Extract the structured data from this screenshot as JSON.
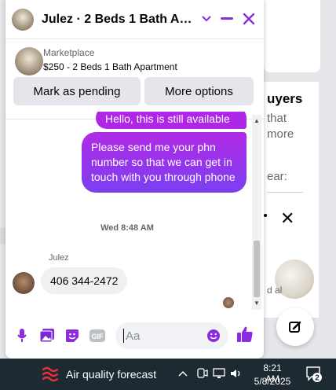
{
  "background": {
    "heading_partial": "uyers",
    "line1_partial": "that",
    "line2_partial": "more",
    "line3_partial": "ear:",
    "thumb_caption_partial": "d al"
  },
  "chat": {
    "title": "Julez · 2 Beds 1 Bath Apartment",
    "listing": {
      "source": "Marketplace",
      "title": "$250 - 2 Beds 1 Bath Apartment",
      "mark_pending_label": "Mark as pending",
      "more_options_label": "More options"
    },
    "messages": {
      "outgoing_1": "Hello, this is still available",
      "outgoing_2": "Please send me your phn number so that we can get in touch with you through phone",
      "timestamp": "Wed 8:48 AM",
      "sender_name": "Julez",
      "incoming_1": "406 344-2472"
    },
    "composer": {
      "placeholder": "Aa",
      "gif_label": "GIF"
    },
    "accent_color": "#8a2be2"
  },
  "taskbar": {
    "weather_label": "Air quality forecast",
    "time": "8:21 AM",
    "date": "5/8/2025",
    "notification_count": "2"
  }
}
